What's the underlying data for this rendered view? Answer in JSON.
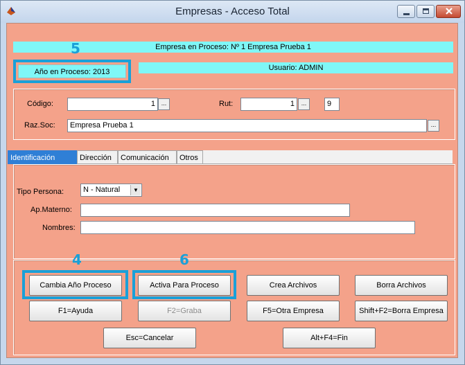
{
  "window": {
    "title": "Empresas - Acceso Total"
  },
  "header": {
    "empresa_proceso": "Empresa en Proceso: Nº 1 Empresa Prueba 1",
    "year_button": "Año en Proceso: 2013",
    "usuario": "Usuario: ADMIN"
  },
  "callouts": {
    "c5": "5",
    "c4": "4",
    "c6": "6"
  },
  "form": {
    "codigo_label": "Código:",
    "codigo_value": "1",
    "rut_label": "Rut:",
    "rut_value": "1",
    "rut_dv": "9",
    "razsoc_label": "Raz.Soc:",
    "razsoc_value": "Empresa Prueba 1",
    "browse": "..."
  },
  "tabs": [
    "Identificación",
    "Dirección",
    "Comunicación",
    "Otros"
  ],
  "identificacion": {
    "tipo_persona_label": "Tipo Persona:",
    "tipo_persona_value": "N - Natural",
    "ap_materno_label": "Ap.Materno:",
    "ap_materno_value": "",
    "nombres_label": "Nombres:",
    "nombres_value": ""
  },
  "buttons": {
    "cambia": "Cambia Año Proceso",
    "activa": "Activa Para Proceso",
    "crea": "Crea Archivos",
    "borra": "Borra Archivos",
    "f1": "F1=Ayuda",
    "f2": "F2=Graba",
    "f5": "F5=Otra Empresa",
    "shiftf2": "Shift+F2=Borra Empresa",
    "esc": "Esc=Cancelar",
    "altf4": "Alt+F4=Fin"
  }
}
